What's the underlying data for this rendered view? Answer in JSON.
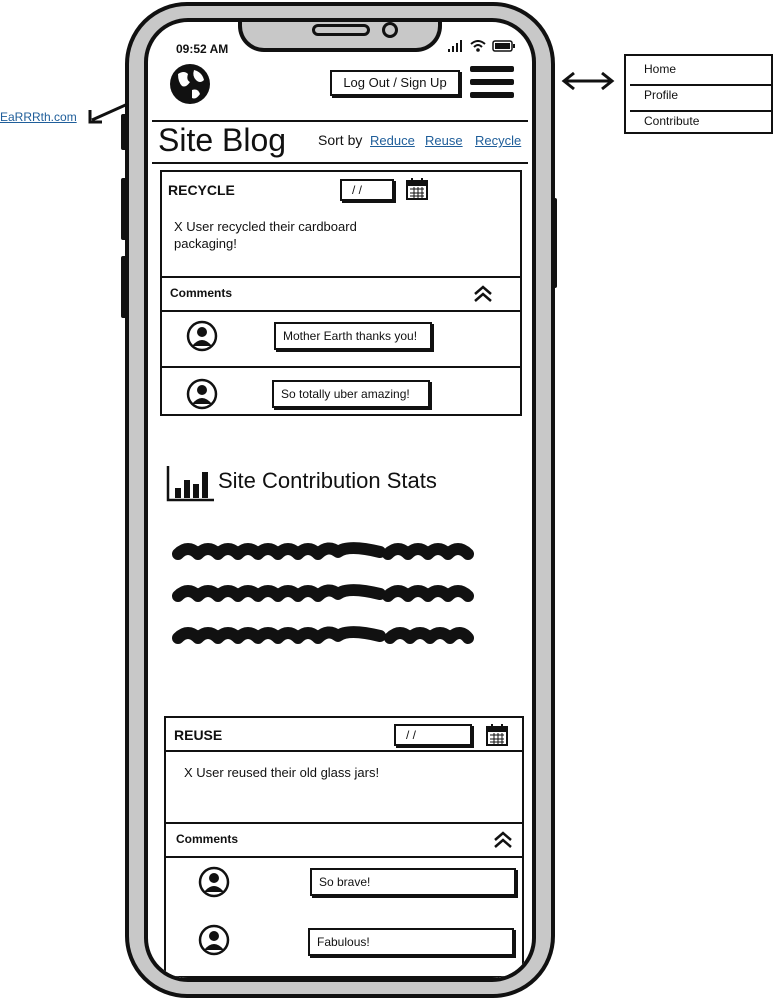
{
  "status_bar": {
    "time": "09:52 AM"
  },
  "header": {
    "auth_label": "Log Out / Sign Up"
  },
  "page": {
    "title": "Site Blog",
    "sort_label": "Sort by",
    "sort_options": [
      "Reduce",
      "Reuse",
      "Recycle"
    ]
  },
  "posts": [
    {
      "category": "RECYCLE",
      "date": "/ /",
      "text_lines": [
        "X User recycled their cardboard",
        "packaging!"
      ],
      "comments_label": "Comments",
      "comments": [
        "Mother Earth thanks you!",
        "So totally uber amazing!"
      ]
    },
    {
      "category": "REUSE",
      "date": "/ /",
      "text_lines": [
        "X User reused their old glass jars!"
      ],
      "comments_label": "Comments",
      "comments": [
        "So brave!",
        "Fabulous!"
      ]
    }
  ],
  "stats": {
    "title": "Site Contribution Stats"
  },
  "annotations": {
    "external_link": "EaRRRth.com",
    "menu_items": [
      "Home",
      "Profile",
      "Contribute"
    ]
  },
  "icons": [
    "globe-icon",
    "hamburger-menu-icon",
    "calendar-icon",
    "chevron-double-up-icon",
    "user-avatar-icon",
    "bar-chart-icon",
    "signal-icon",
    "wifi-icon",
    "battery-icon"
  ]
}
